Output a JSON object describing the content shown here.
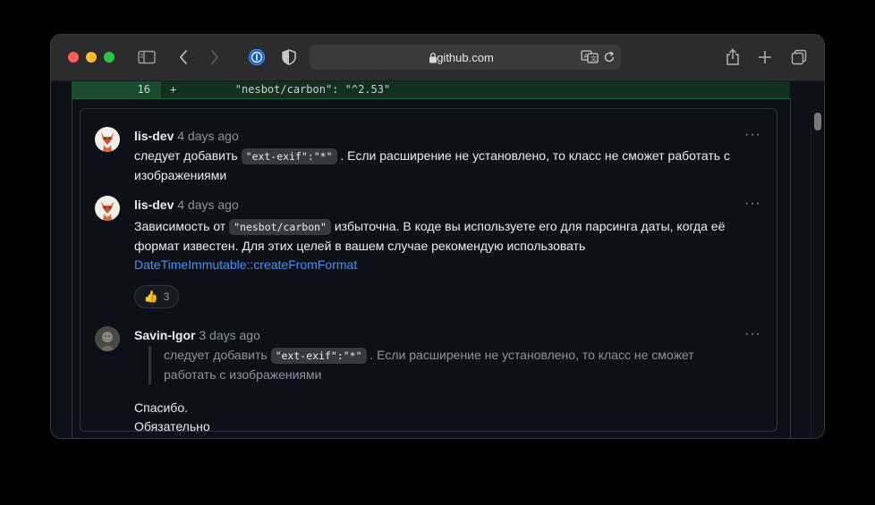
{
  "browser": {
    "address": "github.com",
    "icons": [
      "sidebar-icon",
      "back-icon",
      "forward-icon",
      "password-manager-icon",
      "privacy-shield-icon",
      "lock-icon",
      "translate-icon",
      "reload-icon",
      "share-icon",
      "new-tab-icon",
      "tab-overview-icon"
    ]
  },
  "diff": {
    "line_number": "16",
    "marker": "+",
    "code": "        \"nesbot/carbon\": \"^2.53\""
  },
  "comments": [
    {
      "author": "lis-dev",
      "time": "4 days ago",
      "body_before": "следует добавить ",
      "code": "\"ext-exif\":\"*\"",
      "body_after": " . Если расширение не установлено, то класс не сможет работать с",
      "body_line2": "изображениями"
    },
    {
      "author": "lis-dev",
      "time": "4 days ago",
      "body_before": "Зависимость от ",
      "code": "\"nesbot/carbon\"",
      "body_after": " избыточна. В коде вы используете его для парсинга даты, когда её",
      "body_line2": "формат известен. Для этих целей в вашем случае рекомендую использовать",
      "link": "DateTimeImmutable::createFromFormat",
      "reaction_emoji": "👍",
      "reaction_count": "3"
    },
    {
      "author": "Savin-Igor",
      "time": "3 days ago",
      "quote_before": "следует добавить ",
      "quote_code": "\"ext-exif\":\"*\"",
      "quote_after": " . Если расширение не установлено, то класс не сможет",
      "quote_line2": "работать с изображениями",
      "reply": "Спасибо. Обязательно учту."
    }
  ],
  "menu_label": "···",
  "colors": {
    "accent_link": "#4493f8",
    "diff_add_bg": "#13301f",
    "border": "#30363d"
  }
}
